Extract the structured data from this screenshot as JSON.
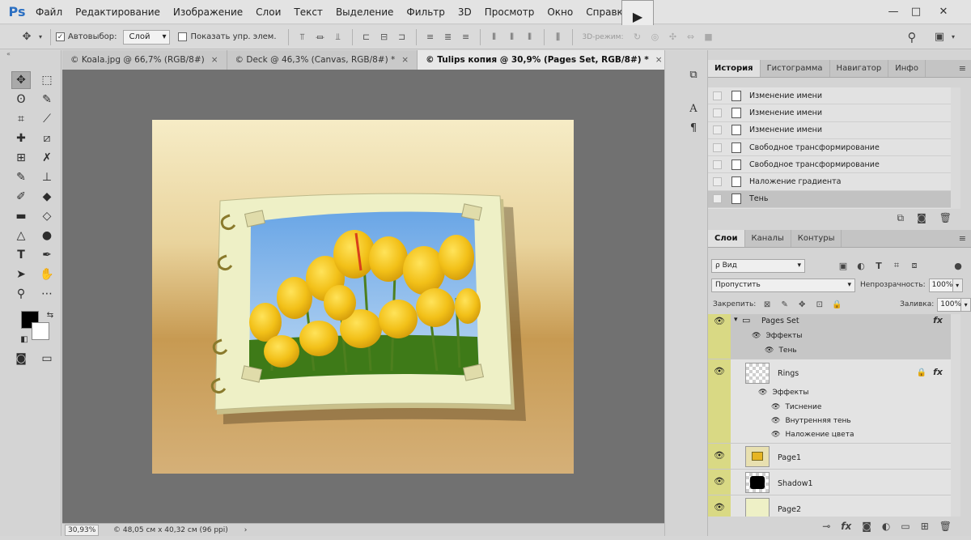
{
  "app": {
    "logo": "Ps"
  },
  "menu": [
    "Файл",
    "Редактирование",
    "Изображение",
    "Слои",
    "Текст",
    "Выделение",
    "Фильтр",
    "3D",
    "Просмотр",
    "Окно",
    "Справка"
  ],
  "window_controls": {
    "minimize": "—",
    "restore": "□",
    "close": "✕"
  },
  "play_button": "▶",
  "options_bar": {
    "autoselect_label": "Автовыбор:",
    "autoselect_checked": "✓",
    "autoselect_value": "Слой",
    "show_controls_label": "Показать упр. элем.",
    "mode_3d_label": "3D-режим:"
  },
  "document_tabs": [
    {
      "label": "© Koala.jpg @ 66,7% (RGB/8#)",
      "close": "×"
    },
    {
      "label": "© Deck @ 46,3% (Canvas, RGB/8#) *",
      "close": "×"
    },
    {
      "label": "© Tulips копия @ 30,9% (Pages Set, RGB/8#) *",
      "close": "×"
    }
  ],
  "status_bar": {
    "zoom": "30,93%",
    "doc_info": "© 48,05 см x 40,32 см (96 ppi)",
    "arrow": "›"
  },
  "history_panel": {
    "tabs": [
      "История",
      "Гистограмма",
      "Навигатор",
      "Инфо"
    ],
    "items": [
      "Изменение имени",
      "Изменение имени",
      "Изменение имени",
      "Свободное трансформирование",
      "Свободное трансформирование",
      "Наложение градиента",
      "Тень"
    ]
  },
  "layers_panel": {
    "tabs": [
      "Слои",
      "Каналы",
      "Контуры"
    ],
    "filter_value": "ρ Вид",
    "blend_mode": "Пропустить",
    "opacity_label": "Непрозрачность:",
    "opacity_value": "100%",
    "lock_label": "Закрепить:",
    "fill_label": "Заливка:",
    "fill_value": "100%",
    "fx_symbol": "fx",
    "layers": [
      {
        "name": "Pages Set",
        "effects_label": "Эффекты",
        "effects": [
          "Тень"
        ]
      },
      {
        "name": "Rings",
        "effects_label": "Эффекты",
        "effects": [
          "Тиснение",
          "Внутренняя тень",
          "Наложение цвета"
        ]
      },
      {
        "name": "Page1"
      },
      {
        "name": "Shadow1"
      },
      {
        "name": "Page2"
      }
    ]
  },
  "colors": {
    "accent_blue": "#2b6fc2",
    "layer_highlight": "#d9d984"
  }
}
